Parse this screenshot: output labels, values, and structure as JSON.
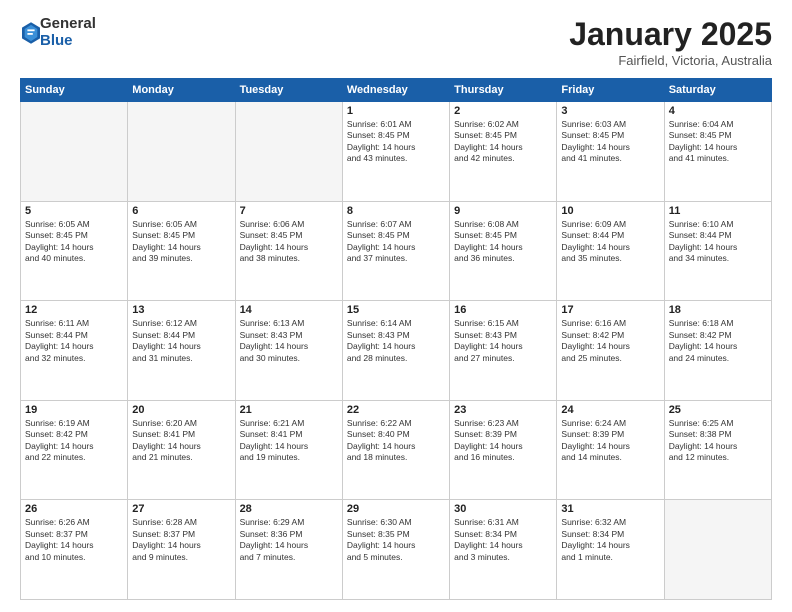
{
  "header": {
    "logo_general": "General",
    "logo_blue": "Blue",
    "month_title": "January 2025",
    "location": "Fairfield, Victoria, Australia"
  },
  "days_of_week": [
    "Sunday",
    "Monday",
    "Tuesday",
    "Wednesday",
    "Thursday",
    "Friday",
    "Saturday"
  ],
  "weeks": [
    [
      {
        "day": "",
        "info": ""
      },
      {
        "day": "",
        "info": ""
      },
      {
        "day": "",
        "info": ""
      },
      {
        "day": "1",
        "info": "Sunrise: 6:01 AM\nSunset: 8:45 PM\nDaylight: 14 hours\nand 43 minutes."
      },
      {
        "day": "2",
        "info": "Sunrise: 6:02 AM\nSunset: 8:45 PM\nDaylight: 14 hours\nand 42 minutes."
      },
      {
        "day": "3",
        "info": "Sunrise: 6:03 AM\nSunset: 8:45 PM\nDaylight: 14 hours\nand 41 minutes."
      },
      {
        "day": "4",
        "info": "Sunrise: 6:04 AM\nSunset: 8:45 PM\nDaylight: 14 hours\nand 41 minutes."
      }
    ],
    [
      {
        "day": "5",
        "info": "Sunrise: 6:05 AM\nSunset: 8:45 PM\nDaylight: 14 hours\nand 40 minutes."
      },
      {
        "day": "6",
        "info": "Sunrise: 6:05 AM\nSunset: 8:45 PM\nDaylight: 14 hours\nand 39 minutes."
      },
      {
        "day": "7",
        "info": "Sunrise: 6:06 AM\nSunset: 8:45 PM\nDaylight: 14 hours\nand 38 minutes."
      },
      {
        "day": "8",
        "info": "Sunrise: 6:07 AM\nSunset: 8:45 PM\nDaylight: 14 hours\nand 37 minutes."
      },
      {
        "day": "9",
        "info": "Sunrise: 6:08 AM\nSunset: 8:45 PM\nDaylight: 14 hours\nand 36 minutes."
      },
      {
        "day": "10",
        "info": "Sunrise: 6:09 AM\nSunset: 8:44 PM\nDaylight: 14 hours\nand 35 minutes."
      },
      {
        "day": "11",
        "info": "Sunrise: 6:10 AM\nSunset: 8:44 PM\nDaylight: 14 hours\nand 34 minutes."
      }
    ],
    [
      {
        "day": "12",
        "info": "Sunrise: 6:11 AM\nSunset: 8:44 PM\nDaylight: 14 hours\nand 32 minutes."
      },
      {
        "day": "13",
        "info": "Sunrise: 6:12 AM\nSunset: 8:44 PM\nDaylight: 14 hours\nand 31 minutes."
      },
      {
        "day": "14",
        "info": "Sunrise: 6:13 AM\nSunset: 8:43 PM\nDaylight: 14 hours\nand 30 minutes."
      },
      {
        "day": "15",
        "info": "Sunrise: 6:14 AM\nSunset: 8:43 PM\nDaylight: 14 hours\nand 28 minutes."
      },
      {
        "day": "16",
        "info": "Sunrise: 6:15 AM\nSunset: 8:43 PM\nDaylight: 14 hours\nand 27 minutes."
      },
      {
        "day": "17",
        "info": "Sunrise: 6:16 AM\nSunset: 8:42 PM\nDaylight: 14 hours\nand 25 minutes."
      },
      {
        "day": "18",
        "info": "Sunrise: 6:18 AM\nSunset: 8:42 PM\nDaylight: 14 hours\nand 24 minutes."
      }
    ],
    [
      {
        "day": "19",
        "info": "Sunrise: 6:19 AM\nSunset: 8:42 PM\nDaylight: 14 hours\nand 22 minutes."
      },
      {
        "day": "20",
        "info": "Sunrise: 6:20 AM\nSunset: 8:41 PM\nDaylight: 14 hours\nand 21 minutes."
      },
      {
        "day": "21",
        "info": "Sunrise: 6:21 AM\nSunset: 8:41 PM\nDaylight: 14 hours\nand 19 minutes."
      },
      {
        "day": "22",
        "info": "Sunrise: 6:22 AM\nSunset: 8:40 PM\nDaylight: 14 hours\nand 18 minutes."
      },
      {
        "day": "23",
        "info": "Sunrise: 6:23 AM\nSunset: 8:39 PM\nDaylight: 14 hours\nand 16 minutes."
      },
      {
        "day": "24",
        "info": "Sunrise: 6:24 AM\nSunset: 8:39 PM\nDaylight: 14 hours\nand 14 minutes."
      },
      {
        "day": "25",
        "info": "Sunrise: 6:25 AM\nSunset: 8:38 PM\nDaylight: 14 hours\nand 12 minutes."
      }
    ],
    [
      {
        "day": "26",
        "info": "Sunrise: 6:26 AM\nSunset: 8:37 PM\nDaylight: 14 hours\nand 10 minutes."
      },
      {
        "day": "27",
        "info": "Sunrise: 6:28 AM\nSunset: 8:37 PM\nDaylight: 14 hours\nand 9 minutes."
      },
      {
        "day": "28",
        "info": "Sunrise: 6:29 AM\nSunset: 8:36 PM\nDaylight: 14 hours\nand 7 minutes."
      },
      {
        "day": "29",
        "info": "Sunrise: 6:30 AM\nSunset: 8:35 PM\nDaylight: 14 hours\nand 5 minutes."
      },
      {
        "day": "30",
        "info": "Sunrise: 6:31 AM\nSunset: 8:34 PM\nDaylight: 14 hours\nand 3 minutes."
      },
      {
        "day": "31",
        "info": "Sunrise: 6:32 AM\nSunset: 8:34 PM\nDaylight: 14 hours\nand 1 minute."
      },
      {
        "day": "",
        "info": ""
      }
    ]
  ]
}
